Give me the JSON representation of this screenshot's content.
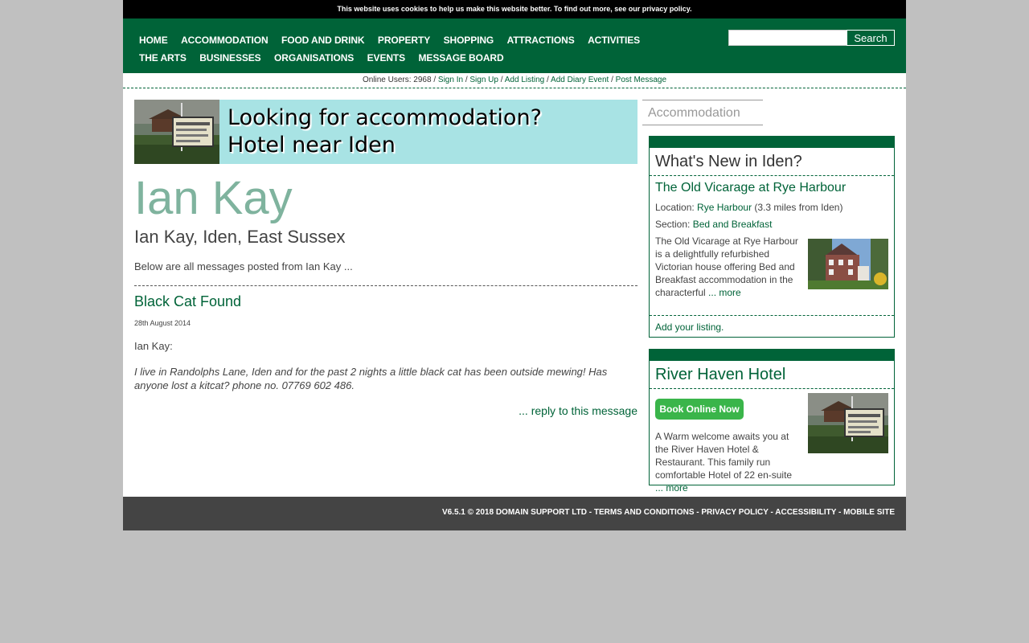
{
  "cookie_notice": "This website uses cookies to help us make this website better. To find out more, see our privacy policy.",
  "nav": {
    "row1": [
      "HOME",
      "ACCOMMODATION",
      "FOOD AND DRINK",
      "PROPERTY",
      "SHOPPING",
      "ATTRACTIONS",
      "ACTIVITIES"
    ],
    "row2": [
      "THE ARTS",
      "BUSINESSES",
      "ORGANISATIONS",
      "EVENTS",
      "MESSAGE BOARD"
    ]
  },
  "search": {
    "value": "",
    "button_label": "Search"
  },
  "userbar": {
    "online": "Online Users: 2968",
    "sep": " / ",
    "sign_in": "Sign In",
    "sign_up": "Sign Up",
    "add_listing": "Add Listing",
    "add_diary": "Add Diary Event",
    "post_message": "Post Message"
  },
  "banner": {
    "line1": "Looking for accommodation?",
    "line2": "Hotel near Iden"
  },
  "main": {
    "title": "Ian Kay",
    "subtitle": "Ian Kay, Iden, East Sussex",
    "intro": "Below are all messages posted from Ian Kay ...",
    "message": {
      "title": "Black Cat Found",
      "date": "28th August 2014",
      "author": "Ian Kay:",
      "body": "I live in Randolphs Lane, Iden and for the past 2 nights a little black cat has been outside mewing! Has anyone lost a kitcat? phone no. 07769 602 486.",
      "reply": "... reply to this message"
    }
  },
  "sidebar": {
    "tab_label": "Accommodation",
    "whats_new": {
      "heading": "What's New in Iden?",
      "listing_title": "The Old Vicarage at Rye Harbour",
      "location_label": "Location: ",
      "location_link": "Rye Harbour",
      "location_dist": " (3.3 miles from Iden)",
      "section_label": "Section: ",
      "section_link": "Bed and Breakfast",
      "description": "The Old Vicarage at Rye Harbour is a delightfully refurbished Victorian house offering Bed and Breakfast accommodation in the characterful",
      "more": " ... more",
      "add_listing": "Add your listing."
    },
    "featured": {
      "heading": "River Haven Hotel",
      "book_label": "Book Online Now",
      "description": "A Warm welcome awaits you at the River Haven Hotel & Restaurant. This family run comfortable Hotel of 22 en-suite",
      "more": " ... more"
    }
  },
  "footer": {
    "version": "V6.5.1 © 2018 DOMAIN SUPPORT LTD",
    "sep": " - ",
    "terms": "TERMS AND CONDITIONS",
    "privacy": "PRIVACY POLICY",
    "accessibility": "ACCESSIBILITY",
    "mobile": "MOBILE SITE"
  },
  "colors": {
    "brand_green": "#006338",
    "banner_bg": "#a8e3e4",
    "title_green": "#7fb39e",
    "book_button": "#3ab54a",
    "footer_bg": "#444444"
  }
}
